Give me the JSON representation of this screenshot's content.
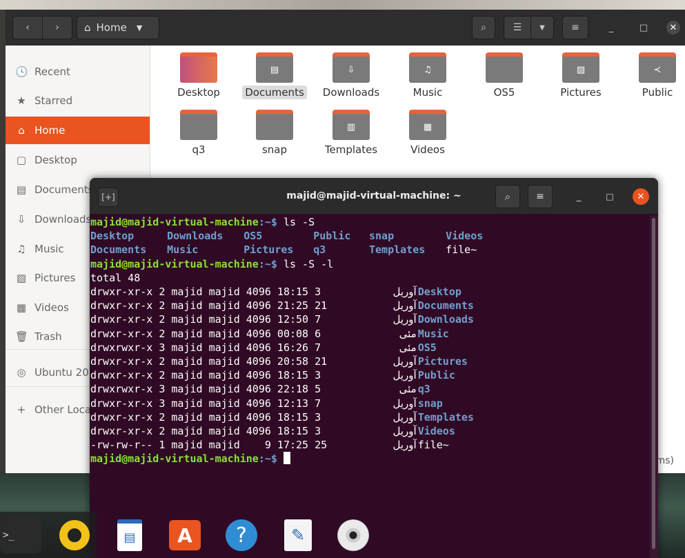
{
  "files": {
    "path_label": "Home",
    "items_count_text": "ems)",
    "sidebar": [
      {
        "label": "Recent",
        "icon": "clock-icon",
        "glyph": "🕓"
      },
      {
        "label": "Starred",
        "icon": "star-icon",
        "glyph": "★"
      },
      {
        "label": "Home",
        "icon": "home-icon",
        "glyph": "⌂"
      },
      {
        "label": "Desktop",
        "icon": "desktop-icon",
        "glyph": "▢"
      },
      {
        "label": "Documents",
        "icon": "document-icon",
        "glyph": "▤"
      },
      {
        "label": "Downloads",
        "icon": "download-icon",
        "glyph": "⇩"
      },
      {
        "label": "Music",
        "icon": "music-icon",
        "glyph": "♫"
      },
      {
        "label": "Pictures",
        "icon": "picture-icon",
        "glyph": "▨"
      },
      {
        "label": "Videos",
        "icon": "video-icon",
        "glyph": "▦"
      },
      {
        "label": "Trash",
        "icon": "trash-icon",
        "glyph": "🗑"
      },
      {
        "label": "Ubuntu 20",
        "icon": "disc-icon",
        "glyph": "◎"
      },
      {
        "label": "Other Loca",
        "icon": "plus-icon",
        "glyph": "+"
      }
    ],
    "folders": [
      {
        "label": "Desktop",
        "glyph": ""
      },
      {
        "label": "Documents",
        "glyph": "▤"
      },
      {
        "label": "Downloads",
        "glyph": "⇩"
      },
      {
        "label": "Music",
        "glyph": "♫"
      },
      {
        "label": "OS5",
        "glyph": ""
      },
      {
        "label": "Pictures",
        "glyph": "▨"
      },
      {
        "label": "Public",
        "glyph": "≺"
      },
      {
        "label": "q3",
        "glyph": ""
      },
      {
        "label": "snap",
        "glyph": ""
      },
      {
        "label": "Templates",
        "glyph": "▥"
      },
      {
        "label": "Videos",
        "glyph": "▦"
      }
    ]
  },
  "terminal": {
    "title": "majid@majid-virtual-machine: ~",
    "prompt_user": "majid@majid-virtual-machine",
    "prompt_path": ":~$",
    "cmd1": " ls -S",
    "ls_row1": [
      "Desktop",
      "Downloads",
      "OS5",
      "Public",
      "snap",
      "Videos"
    ],
    "ls_row2": [
      "Documents",
      "Music",
      "Pictures",
      "q3",
      "Templates"
    ],
    "ls_row2_plain": "file~",
    "cmd2": " ls -S -l",
    "total": "total 48",
    "long_rows": [
      {
        "meta": "drwxr-xr-x 2 majid majid 4096 18:15 3",
        "month": "آوریل",
        "name": "Desktop"
      },
      {
        "meta": "drwxr-xr-x 2 majid majid 4096 21:25 21",
        "month": "آوریل",
        "name": "Documents"
      },
      {
        "meta": "drwxr-xr-x 2 majid majid 4096 12:50 7",
        "month": "آوریل",
        "name": "Downloads"
      },
      {
        "meta": "drwxr-xr-x 2 majid majid 4096 00:08 6",
        "month": "مئی",
        "name": "Music"
      },
      {
        "meta": "drwxrwxr-x 3 majid majid 4096 16:26 7",
        "month": "مئی",
        "name": "OS5"
      },
      {
        "meta": "drwxr-xr-x 2 majid majid 4096 20:58 21",
        "month": "آوریل",
        "name": "Pictures"
      },
      {
        "meta": "drwxr-xr-x 2 majid majid 4096 18:15 3",
        "month": "آوریل",
        "name": "Public"
      },
      {
        "meta": "drwxrwxr-x 3 majid majid 4096 22:18 5",
        "month": "مئی",
        "name": "q3"
      },
      {
        "meta": "drwxr-xr-x 3 majid majid 4096 12:13 7",
        "month": "آوریل",
        "name": "snap"
      },
      {
        "meta": "drwxr-xr-x 2 majid majid 4096 18:15 3",
        "month": "آوریل",
        "name": "Templates"
      },
      {
        "meta": "drwxr-xr-x 2 majid majid 4096 18:15 3",
        "month": "آوریل",
        "name": "Videos"
      },
      {
        "meta": "-rw-rw-r-- 1 majid majid    9 17:25 25",
        "month": "آوریل",
        "name": "file~",
        "plain": true
      }
    ],
    "final_prompt_suffix": " "
  },
  "dock": {
    "terminal_glyph": ">_"
  },
  "colors": {
    "accent": "#e95420",
    "terminal_bg": "#300a24",
    "prompt_green": "#8ae234",
    "dir_blue": "#729fcf"
  }
}
